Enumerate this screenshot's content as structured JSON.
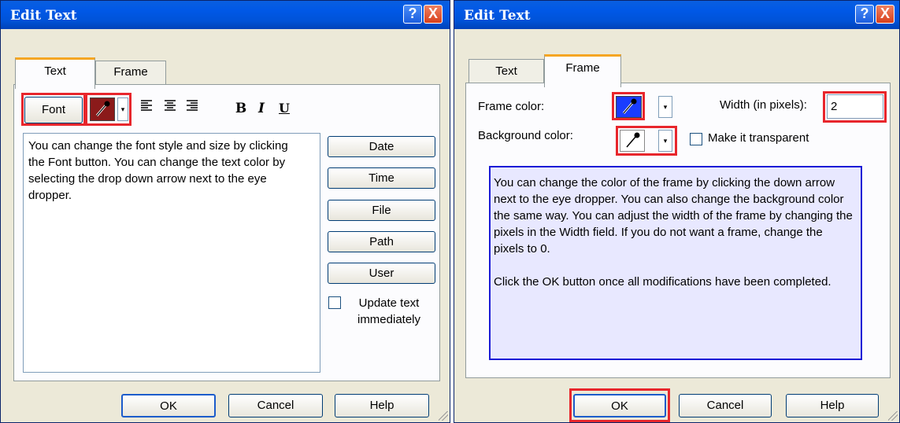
{
  "left_dialog": {
    "title": "Edit Text",
    "help_glyph": "?",
    "close_glyph": "X",
    "tabs": [
      "Text",
      "Frame"
    ],
    "font_button": "Font",
    "format_buttons": {
      "bold": "B",
      "italic": "I",
      "underline": "U"
    },
    "text_content": "You can change the font style and size by clicking the Font button.  You can change the text color by selecting the drop down arrow next to the eye dropper.",
    "insert_buttons": [
      "Date",
      "Time",
      "File",
      "Path",
      "User"
    ],
    "update_checkbox_label": "Update text immediately",
    "bottom_buttons": {
      "ok": "OK",
      "cancel": "Cancel",
      "help": "Help"
    }
  },
  "right_dialog": {
    "title": "Edit Text",
    "help_glyph": "?",
    "close_glyph": "X",
    "tabs": [
      "Text",
      "Frame"
    ],
    "frame_color_label": "Frame color:",
    "background_color_label": "Background color:",
    "width_label": "Width (in pixels):",
    "width_value": "2",
    "transparent_label": "Make it transparent",
    "info_paragraph1": "You can change the color of the frame by clicking the down arrow next to the eye dropper.  You can also change the background color the same way.  You can adjust the width of the frame by changing the pixels in the Width field.  If you do not want a frame, change the pixels to 0.",
    "info_paragraph2": "Click the OK button once all modifications have been completed.",
    "bottom_buttons": {
      "ok": "OK",
      "cancel": "Cancel",
      "help": "Help"
    }
  },
  "icons": [
    "eyedropper-icon",
    "align-left-icon",
    "align-center-icon",
    "align-right-icon",
    "chevron-down-icon",
    "resize-grip-icon"
  ],
  "colors": {
    "highlight": "#e8262c",
    "title_bar": "#0058e6",
    "frame_color_swatch": "#1a3cff",
    "text_color_swatch": "#8b1a1a",
    "info_box_bg": "#e8e8ff",
    "info_box_border": "#1b1bd6"
  }
}
